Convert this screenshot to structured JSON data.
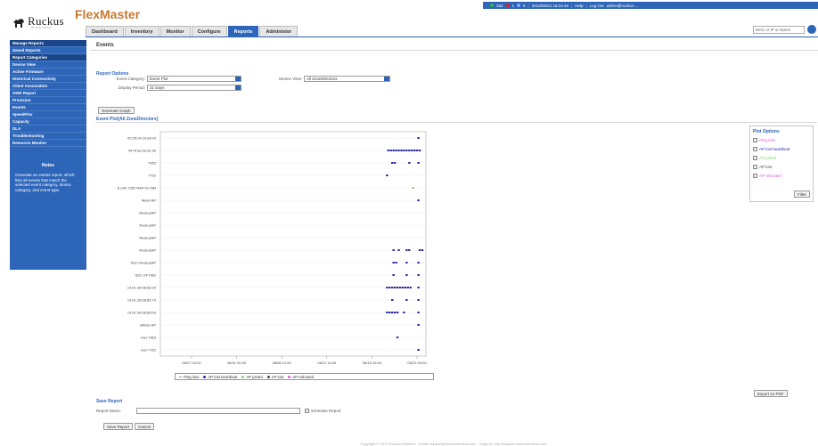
{
  "header": {
    "logo_text": "Ruckus",
    "logo_sub": "WIRELESS",
    "app_title": "FlexMaster",
    "status": {
      "green_count": "262",
      "red_count": "1",
      "blue_count": "5",
      "datetime": "2013/06/21 18:24:46",
      "help": "Help",
      "logout": "Log Out",
      "user": "admin@ruckus-…",
      "colors": {
        "green": "#37b34a",
        "red": "#d9232d",
        "blue": "#7fb2ff"
      }
    },
    "search_placeholder": "MAC or IP or Name"
  },
  "tabs": [
    {
      "label": "Dashboard",
      "active": false
    },
    {
      "label": "Inventory",
      "active": false
    },
    {
      "label": "Monitor",
      "active": false
    },
    {
      "label": "Configure",
      "active": false
    },
    {
      "label": "Reports",
      "active": true
    },
    {
      "label": "Administer",
      "active": false
    }
  ],
  "sidebar": {
    "items": [
      {
        "label": "Manage Reports",
        "kind": "head"
      },
      {
        "label": "Saved Reports",
        "kind": "item"
      },
      {
        "label": "Report Categories",
        "kind": "head"
      },
      {
        "label": "Device View",
        "kind": "item"
      },
      {
        "label": "Active Firmware",
        "kind": "item"
      },
      {
        "label": "Historical Connectivity",
        "kind": "item"
      },
      {
        "label": "Client Association",
        "kind": "item"
      },
      {
        "label": "SSID Report",
        "kind": "item"
      },
      {
        "label": "Provision",
        "kind": "item"
      },
      {
        "label": "Events",
        "kind": "active"
      },
      {
        "label": "SpeedFlex",
        "kind": "item"
      },
      {
        "label": "Capacity",
        "kind": "item"
      },
      {
        "label": "DLA",
        "kind": "item"
      },
      {
        "label": "Troubleshooting",
        "kind": "item"
      },
      {
        "label": "Resource Monitor",
        "kind": "item"
      }
    ],
    "notes_title": "Notes",
    "notes_text": "Generate an events report, which lists all events that match the selected event category, device category, and event type."
  },
  "main": {
    "page_title": "Events",
    "report_options": {
      "title": "Report Options",
      "event_category_label": "Event Category:",
      "event_category_value": "Event Plot",
      "device_view_label": "Device View:",
      "device_view_value": "All ZoneDirectors",
      "display_period_label": "Display Period:",
      "display_period_value": "31 Days",
      "generate_button": "Generate Graph"
    },
    "event_plot_title": "Event Plot[All ZoneDirectors]",
    "plot_options": {
      "title": "Plot Options",
      "items": [
        {
          "label": "Ping loss",
          "color": "#e05ad8"
        },
        {
          "label": "AP lost heartbeat",
          "color": "#2a2aa8"
        },
        {
          "label": "AP joined",
          "color": "#7fd66a"
        },
        {
          "label": "AP lost",
          "color": "#444444"
        },
        {
          "label": "AP rebooted",
          "color": "#e05ad8"
        }
      ],
      "filter_button": "Filter"
    },
    "save_report": {
      "title": "Save Report",
      "name_label": "Report Name:",
      "name_value": "",
      "schedule_label": "Schedule Report",
      "save_button": "Save Report",
      "cancel_button": "Cancel"
    },
    "export_button": "Export As PDF",
    "footer": "Copyright © 2013 Ruckus Wireless · Email: support@ruckuswireless.com · Support: http://support.ruckuswireless.com"
  },
  "chart_data": {
    "type": "scatter",
    "title": "",
    "xlabel": "",
    "ylabel": "",
    "x_ticks": [
      "05/27 04:00",
      "06/01 00:00",
      "06/06 12:00",
      "06/11 14:00",
      "06/16 20:00",
      "06/22 00:00"
    ],
    "categories": [
      "00:25:c4:19:e4:b0",
      "04:4f:aa:2a:5c:30",
      "7352",
      "7762",
      "8 Unit 7352 RAP for MM",
      "Mesh AP",
      "RuckusAP",
      "RuckusAP",
      "RuckusAP",
      "RuckusAP",
      "SDC-RuckusAP",
      "SDC-ZF7962",
      "c4:01:39:08:83:20",
      "c4:01:39:08:85:70",
      "c4:01:39:08:85:b0",
      "eMesh AP",
      "nan-7363",
      "nan-7762"
    ],
    "legend": [
      "Ping loss",
      "AP lost heartbeat",
      "AP joined",
      "AP lost",
      "AP rebooted"
    ],
    "series": [
      {
        "name": "AP lost heartbeat",
        "color": "#2a2aa8",
        "points": [
          {
            "row": 0,
            "t": 0.985
          },
          {
            "row": 1,
            "t": 0.87
          },
          {
            "row": 1,
            "t": 0.88
          },
          {
            "row": 1,
            "t": 0.89
          },
          {
            "row": 1,
            "t": 0.9
          },
          {
            "row": 1,
            "t": 0.91
          },
          {
            "row": 1,
            "t": 0.92
          },
          {
            "row": 1,
            "t": 0.93
          },
          {
            "row": 1,
            "t": 0.94
          },
          {
            "row": 1,
            "t": 0.95
          },
          {
            "row": 1,
            "t": 0.96
          },
          {
            "row": 1,
            "t": 0.97
          },
          {
            "row": 1,
            "t": 0.98
          },
          {
            "row": 1,
            "t": 0.99
          },
          {
            "row": 2,
            "t": 0.885
          },
          {
            "row": 2,
            "t": 0.895
          },
          {
            "row": 2,
            "t": 0.95
          },
          {
            "row": 2,
            "t": 0.985
          },
          {
            "row": 3,
            "t": 0.865
          },
          {
            "row": 5,
            "t": 0.985
          },
          {
            "row": 9,
            "t": 0.89
          },
          {
            "row": 9,
            "t": 0.91
          },
          {
            "row": 9,
            "t": 0.94
          },
          {
            "row": 9,
            "t": 0.95
          },
          {
            "row": 9,
            "t": 0.99
          },
          {
            "row": 9,
            "t": 1.0
          },
          {
            "row": 10,
            "t": 0.89
          },
          {
            "row": 10,
            "t": 0.9
          },
          {
            "row": 10,
            "t": 0.94
          },
          {
            "row": 10,
            "t": 0.985
          },
          {
            "row": 11,
            "t": 0.89
          },
          {
            "row": 11,
            "t": 0.94
          },
          {
            "row": 11,
            "t": 0.985
          },
          {
            "row": 12,
            "t": 0.865
          },
          {
            "row": 12,
            "t": 0.875
          },
          {
            "row": 12,
            "t": 0.885
          },
          {
            "row": 12,
            "t": 0.895
          },
          {
            "row": 12,
            "t": 0.905
          },
          {
            "row": 12,
            "t": 0.915
          },
          {
            "row": 12,
            "t": 0.925
          },
          {
            "row": 12,
            "t": 0.935
          },
          {
            "row": 12,
            "t": 0.945
          },
          {
            "row": 12,
            "t": 0.955
          },
          {
            "row": 12,
            "t": 0.985
          },
          {
            "row": 13,
            "t": 0.885
          },
          {
            "row": 13,
            "t": 0.94
          },
          {
            "row": 13,
            "t": 0.985
          },
          {
            "row": 14,
            "t": 0.865
          },
          {
            "row": 14,
            "t": 0.875
          },
          {
            "row": 14,
            "t": 0.885
          },
          {
            "row": 14,
            "t": 0.895
          },
          {
            "row": 14,
            "t": 0.905
          },
          {
            "row": 14,
            "t": 0.93
          },
          {
            "row": 14,
            "t": 0.985
          },
          {
            "row": 15,
            "t": 0.985
          },
          {
            "row": 16,
            "t": 0.905
          },
          {
            "row": 17,
            "t": 0.985
          }
        ]
      },
      {
        "name": "AP joined",
        "color": "#7fd66a",
        "points": [
          {
            "row": 4,
            "t": 0.965
          }
        ]
      }
    ]
  }
}
